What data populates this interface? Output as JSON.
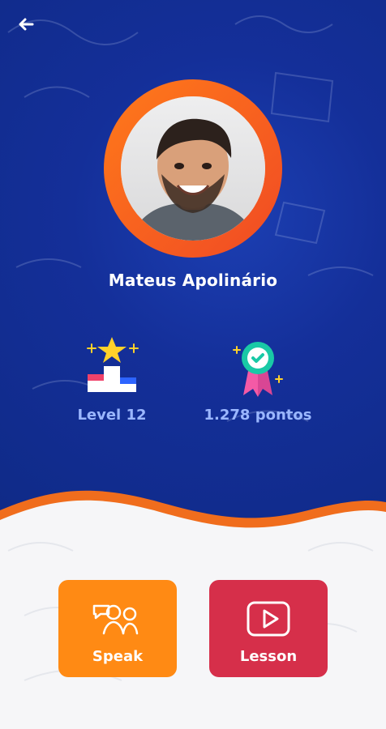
{
  "profile": {
    "name": "Mateus Apolinário",
    "level_label": "Level 12",
    "points_label": "1.278 pontos"
  },
  "actions": {
    "speak_label": "Speak",
    "lesson_label": "Lesson"
  },
  "icons": {
    "back": "back-arrow-icon",
    "level": "podium-star-icon",
    "points": "award-badge-icon",
    "speak": "people-chat-icon",
    "lesson": "video-play-icon"
  },
  "colors": {
    "hero_blue": "#142f99",
    "orange": "#ff8a14",
    "red": "#d62f4a",
    "stat_text": "#9bb7ff"
  }
}
